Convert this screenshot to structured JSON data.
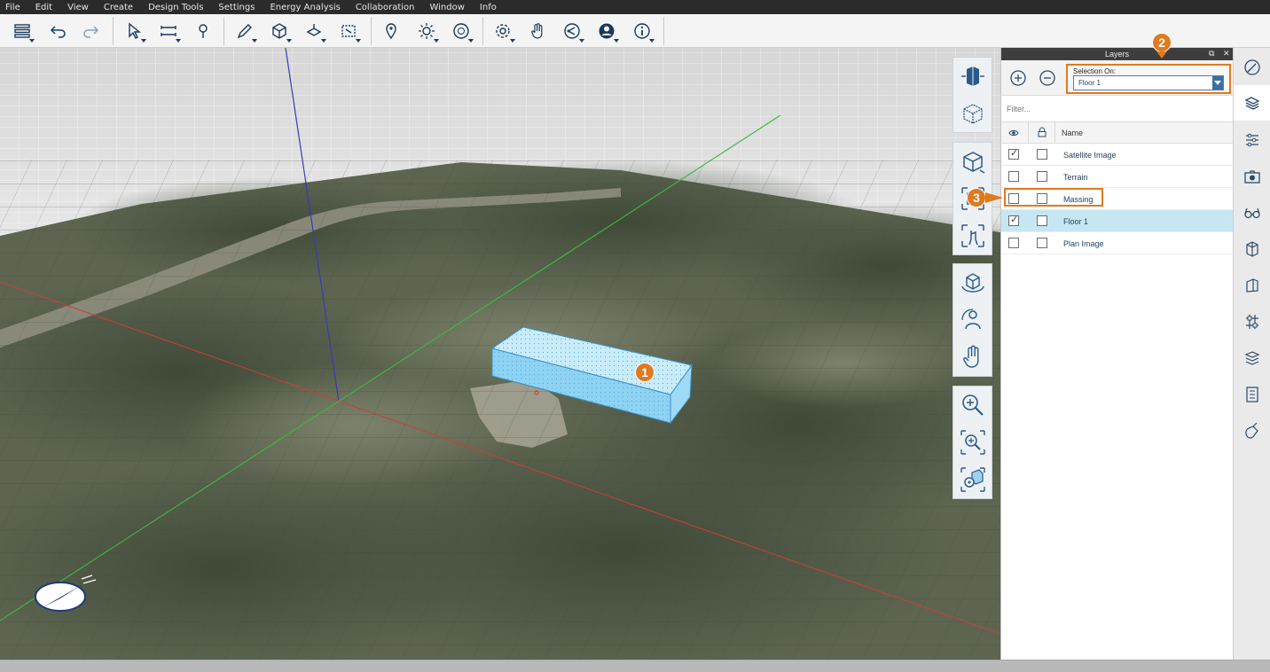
{
  "menu": [
    "File",
    "Edit",
    "View",
    "Create",
    "Design Tools",
    "Settings",
    "Energy Analysis",
    "Collaboration",
    "Window",
    "Info"
  ],
  "toolbar_icons": [
    "layers-menu-icon",
    "undo-icon",
    "redo-icon",
    "select-icon",
    "measure-icon",
    "pin-icon",
    "sketch-pencil-icon",
    "box-create-icon",
    "transform-icon",
    "grid-crop-icon",
    "location-icon",
    "sun-icon",
    "time-icon",
    "settings-gear-icon",
    "hand-gesture-icon",
    "share-icon",
    "user-icon",
    "info-icon"
  ],
  "layers_panel": {
    "title": "Layers",
    "selection_on_label": "Selection On:",
    "selection_value": "Floor 1",
    "filter_placeholder": "Filter...",
    "name_header": "Name",
    "rows": [
      {
        "name": "Satellite Image",
        "visible": true,
        "locked": false,
        "selected": false
      },
      {
        "name": "Terrain",
        "visible": false,
        "locked": false,
        "selected": false
      },
      {
        "name": "Massing",
        "visible": false,
        "locked": false,
        "selected": false
      },
      {
        "name": "Floor 1",
        "visible": true,
        "locked": false,
        "selected": true
      },
      {
        "name": "Plan Image",
        "visible": false,
        "locked": false,
        "selected": false
      }
    ]
  },
  "callouts": [
    "1",
    "2",
    "3"
  ],
  "colors": {
    "accent": "#e07a1f",
    "selection": "#c6e6f2",
    "massing": "#8fd3f4",
    "x_axis": "#d23a3a",
    "y_axis": "#3fb83f",
    "z_axis": "#3a3ab8"
  },
  "nav_icons": [
    "view-cube-front-icon",
    "view-cube-iso-icon",
    "perspective-box-icon",
    "zoom-selection-icon",
    "walk-icon",
    "orbit-icon",
    "look-icon",
    "pan-hand-icon",
    "zoom-in-icon",
    "zoom-window-icon",
    "zoom-extents-icon"
  ],
  "right_strip_icons": [
    "sketch-icon",
    "layers-stack-icon",
    "properties-icon",
    "camera-icon",
    "glasses-icon",
    "cube-open-icon",
    "frame-icon",
    "structure-icon",
    "levels-icon",
    "schedule-icon",
    "paint-icon"
  ]
}
